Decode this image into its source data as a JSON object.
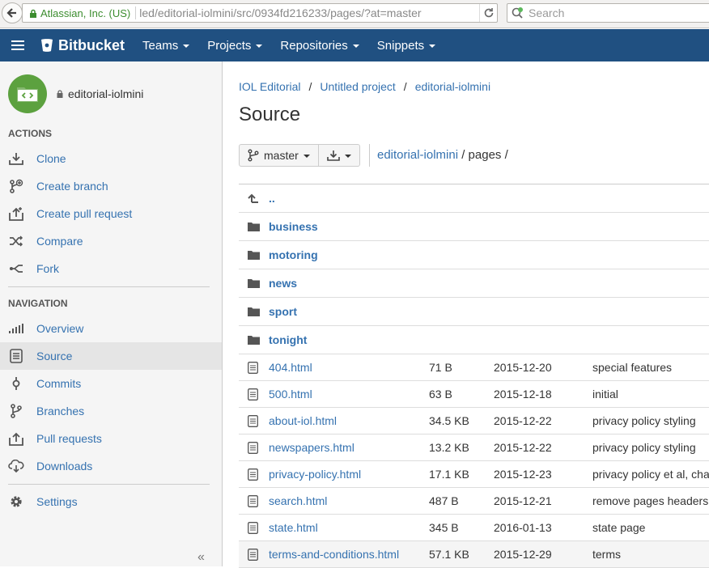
{
  "browser": {
    "identity": "Atlassian, Inc. (US)",
    "url": "led/editorial-iolmini/src/0934fd216233/pages/?at=master",
    "search_placeholder": "Search"
  },
  "header": {
    "logo_text": "Bitbucket",
    "nav": [
      {
        "label": "Teams"
      },
      {
        "label": "Projects"
      },
      {
        "label": "Repositories"
      },
      {
        "label": "Snippets"
      }
    ]
  },
  "sidebar": {
    "repo_name": "editorial-iolmini",
    "actions_title": "ACTIONS",
    "actions": [
      {
        "label": "Clone",
        "icon": "download-icon"
      },
      {
        "label": "Create branch",
        "icon": "branch-add-icon"
      },
      {
        "label": "Create pull request",
        "icon": "upload-icon"
      },
      {
        "label": "Compare",
        "icon": "shuffle-icon"
      },
      {
        "label": "Fork",
        "icon": "fork-icon"
      }
    ],
    "navigation_title": "NAVIGATION",
    "navigation": [
      {
        "label": "Overview",
        "icon": "bar-chart-icon"
      },
      {
        "label": "Source",
        "icon": "document-icon"
      },
      {
        "label": "Commits",
        "icon": "commit-icon"
      },
      {
        "label": "Branches",
        "icon": "branch-icon"
      },
      {
        "label": "Pull requests",
        "icon": "pull-request-icon"
      },
      {
        "label": "Downloads",
        "icon": "cloud-download-icon"
      }
    ],
    "settings_label": "Settings",
    "collapse_label": "«"
  },
  "main": {
    "breadcrumbs": [
      "IOL Editorial",
      "Untitled project",
      "editorial-iolmini"
    ],
    "breadcrumb_sep": "/",
    "title": "Source",
    "branch_label": "master",
    "path_repo": "editorial-iolmini",
    "path_rest": " / pages /",
    "parent_label": "..",
    "directories": [
      "business",
      "motoring",
      "news",
      "sport",
      "tonight"
    ],
    "files": [
      {
        "name": "404.html",
        "size": "71 B",
        "date": "2015-12-20",
        "message": "special features"
      },
      {
        "name": "500.html",
        "size": "63 B",
        "date": "2015-12-18",
        "message": "initial"
      },
      {
        "name": "about-iol.html",
        "size": "34.5 KB",
        "date": "2015-12-22",
        "message": "privacy policy styling"
      },
      {
        "name": "newspapers.html",
        "size": "13.2 KB",
        "date": "2015-12-22",
        "message": "privacy policy styling"
      },
      {
        "name": "privacy-policy.html",
        "size": "17.1 KB",
        "date": "2015-12-23",
        "message": "privacy policy et al, cha"
      },
      {
        "name": "search.html",
        "size": "487 B",
        "date": "2015-12-21",
        "message": "remove pages headers"
      },
      {
        "name": "state.html",
        "size": "345 B",
        "date": "2016-01-13",
        "message": "state page"
      },
      {
        "name": "terms-and-conditions.html",
        "size": "57.1 KB",
        "date": "2015-12-29",
        "message": "terms"
      }
    ]
  },
  "colors": {
    "header_bg": "#205081",
    "link": "#3572b0",
    "avatar": "#5ca13f",
    "identity_green": "#3c8d2f"
  }
}
